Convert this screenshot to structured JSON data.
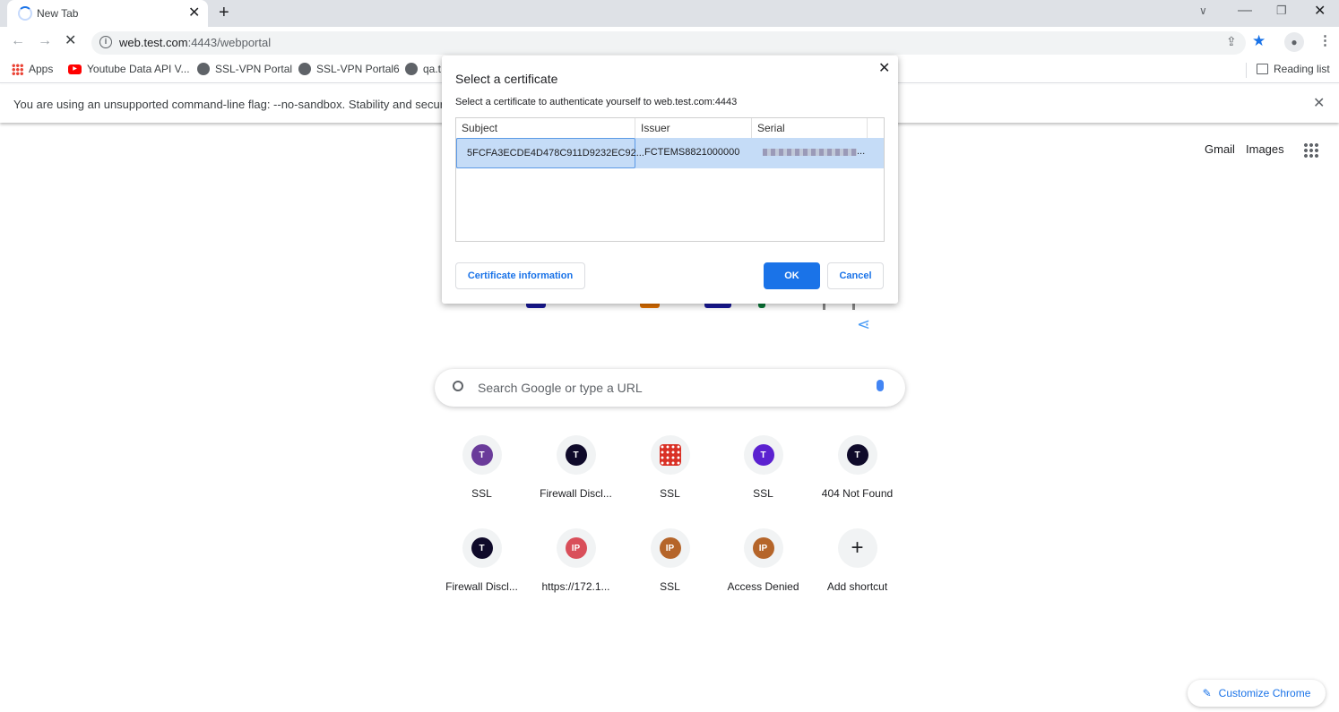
{
  "browser": {
    "tab_title": "New Tab",
    "url_host": "web.test.com",
    "url_path": ":4443/webportal"
  },
  "bookmarks": [
    {
      "label": "Apps",
      "icon": "apps-icon"
    },
    {
      "label": "Youtube Data API V...",
      "icon": "youtube-icon"
    },
    {
      "label": "SSL-VPN Portal",
      "icon": "globe-icon"
    },
    {
      "label": "SSL-VPN Portal6",
      "icon": "globe-icon"
    },
    {
      "label": "qa.t",
      "icon": "globe-icon"
    }
  ],
  "reading_list": "Reading list",
  "infobar": {
    "message": "You are using an unsupported command-line flag: --no-sandbox. Stability and security wi"
  },
  "ntp": {
    "gmail": "Gmail",
    "images": "Images",
    "search_placeholder": "Search Google or type a URL",
    "customize": "Customize Chrome",
    "shortcuts": [
      {
        "label": "SSL",
        "letter": "T",
        "color": "#6a3b9a"
      },
      {
        "label": "Firewall Discl...",
        "letter": "T",
        "color": "#0f0a2a"
      },
      {
        "label": "SSL",
        "letter": "",
        "color": "#d93025"
      },
      {
        "label": "SSL",
        "letter": "T",
        "color": "#5b21d0"
      },
      {
        "label": "404 Not Found",
        "letter": "T",
        "color": "#0f0a2a"
      },
      {
        "label": "Firewall Discl...",
        "letter": "T",
        "color": "#0f0a2a"
      },
      {
        "label": "https://172.1...",
        "letter": "IP",
        "color": "#d94f5a"
      },
      {
        "label": "SSL",
        "letter": "IP",
        "color": "#b5652a"
      },
      {
        "label": "Access Denied",
        "letter": "IP",
        "color": "#b5652a"
      },
      {
        "label": "Add shortcut",
        "letter": "+",
        "color": ""
      }
    ]
  },
  "dialog": {
    "title": "Select a certificate",
    "subtitle": "Select a certificate to authenticate yourself to web.test.com:4443",
    "columns": [
      "Subject",
      "Issuer",
      "Serial"
    ],
    "rows": [
      {
        "subject": "5FCFA3ECDE4D478C911D9232EC92...",
        "issuer": "FCTEMS8821000000",
        "serial": "..."
      }
    ],
    "cert_info": "Certificate information",
    "ok": "OK",
    "cancel": "Cancel"
  }
}
